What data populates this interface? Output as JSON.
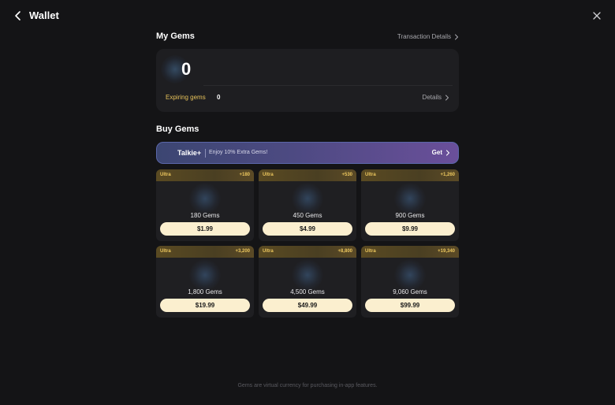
{
  "header": {
    "title": "Wallet"
  },
  "my_gems": {
    "title": "My Gems",
    "transaction_link": "Transaction Details",
    "balance": "0",
    "expiring_label": "Expiring gems",
    "expiring_value": "0",
    "details_link": "Details"
  },
  "buy_gems": {
    "title": "Buy Gems",
    "promo": {
      "brand": "Talkie+",
      "text": "Enjoy 10% Extra Gems!",
      "cta": "Get"
    },
    "packages": [
      {
        "tag": "Ultra",
        "bonus": "+180",
        "quantity": "180 Gems",
        "price": "$1.99"
      },
      {
        "tag": "Ultra",
        "bonus": "+530",
        "quantity": "450 Gems",
        "price": "$4.99"
      },
      {
        "tag": "Ultra",
        "bonus": "+1,260",
        "quantity": "900 Gems",
        "price": "$9.99"
      },
      {
        "tag": "Ultra",
        "bonus": "+3,200",
        "quantity": "1,800 Gems",
        "price": "$19.99"
      },
      {
        "tag": "Ultra",
        "bonus": "+8,800",
        "quantity": "4,500 Gems",
        "price": "$49.99"
      },
      {
        "tag": "Ultra",
        "bonus": "+19,340",
        "quantity": "9,060 Gems",
        "price": "$99.99"
      }
    ]
  },
  "footer": {
    "note": "Gems are virtual currency for purchasing in-app features."
  },
  "icons": {
    "back": "chevron-left-icon",
    "close": "close-icon",
    "chevron": "chevron-right-icon"
  },
  "colors": {
    "background": "#141416",
    "card": "#1e1e21",
    "accent_gold": "#e7c25a",
    "price_button": "#fbefcf",
    "promo_start": "#3c4672",
    "promo_end": "#6a4f9a"
  }
}
